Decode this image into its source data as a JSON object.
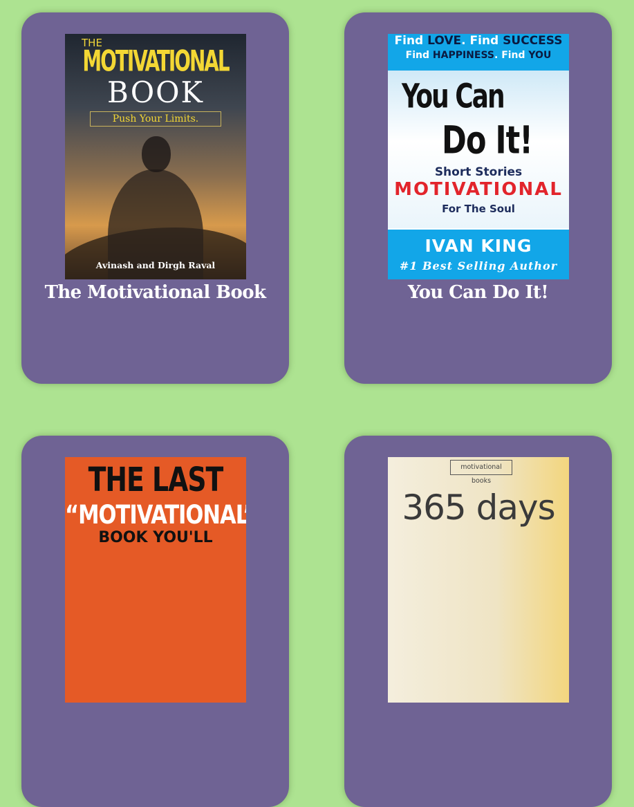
{
  "books": [
    {
      "title": "The Motivational Book",
      "cover": {
        "the": "THE",
        "main": "MOTIVATIONAL",
        "book": "BOOK",
        "tagline": "Push Your Limits.",
        "author": "Avinash and Dirgh Raval"
      }
    },
    {
      "title": "You Can Do It!",
      "cover": {
        "line1a": "Find ",
        "line1b": "LOVE",
        "line1c": ". Find ",
        "line1d": "SUCCESS",
        "line2a": "Find ",
        "line2b": "HAPPINESS",
        "line2c": ". Find ",
        "line2d": "YOU",
        "you_can": "You Can",
        "do_it": "Do It!",
        "short_stories": "Short Stories",
        "motivational": "MOTIVATIONAL",
        "for_soul": "For The Soul",
        "author": "IVAN KING",
        "badge": "#1 Best Selling Author"
      }
    },
    {
      "title": "",
      "cover": {
        "line1": "THE LAST",
        "line2": "“MOTIVATIONAL”",
        "line3": "BOOK YOU'LL"
      }
    },
    {
      "title": "",
      "cover": {
        "tag": "motivational books",
        "main": "365 days"
      }
    }
  ]
}
